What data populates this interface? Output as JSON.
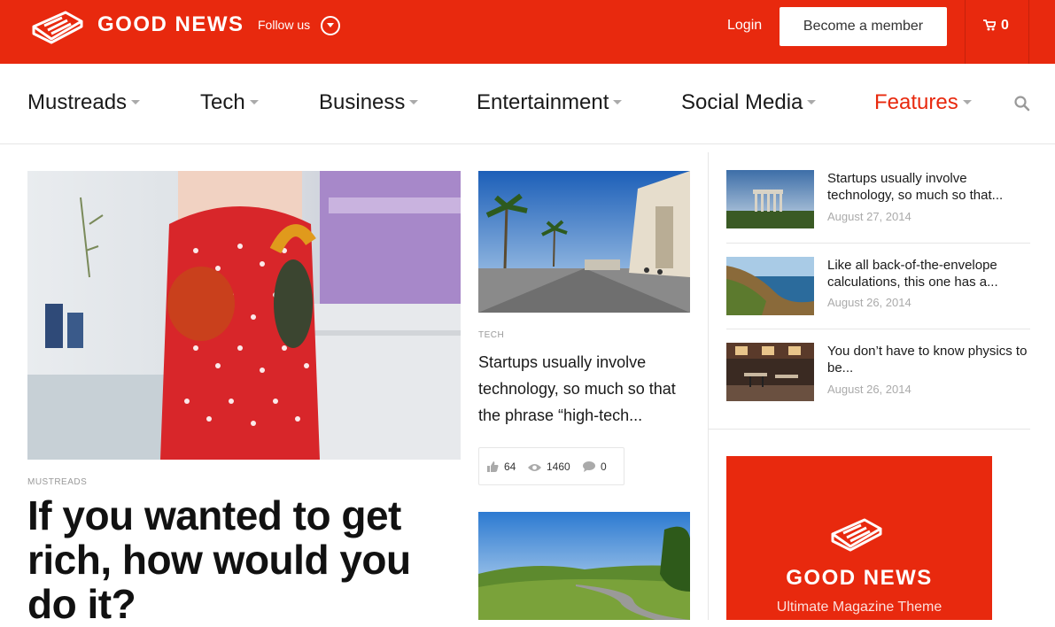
{
  "header": {
    "brand": "GOOD NEWS",
    "follow_label": "Follow us",
    "login_label": "Login",
    "member_button": "Become a member",
    "cart_count": "0",
    "accent_color": "#e8290e"
  },
  "nav": {
    "items": [
      {
        "label": "Mustreads"
      },
      {
        "label": "Tech"
      },
      {
        "label": "Business"
      },
      {
        "label": "Entertainment"
      },
      {
        "label": "Social Media"
      },
      {
        "label": "Features"
      }
    ],
    "active": "Features"
  },
  "hero": {
    "category": "MUSTREADS",
    "title": "If you wanted to get rich, how would you do it?"
  },
  "middle": {
    "category": "TECH",
    "title": "Startups usually involve technology, so much so that the phrase “high-tech...",
    "likes": "64",
    "views": "1460",
    "comments": "0"
  },
  "sidebar": {
    "items": [
      {
        "title": "Startups usually involve technology, so much so that...",
        "date": "August 27, 2014"
      },
      {
        "title": "Like all back-of-the-envelope calculations, this one has a...",
        "date": "August 26, 2014"
      },
      {
        "title": "You don’t have to know physics to be...",
        "date": "August 26, 2014"
      }
    ]
  },
  "promo": {
    "brand": "GOOD NEWS",
    "tagline": "Ultimate Magazine Theme"
  }
}
